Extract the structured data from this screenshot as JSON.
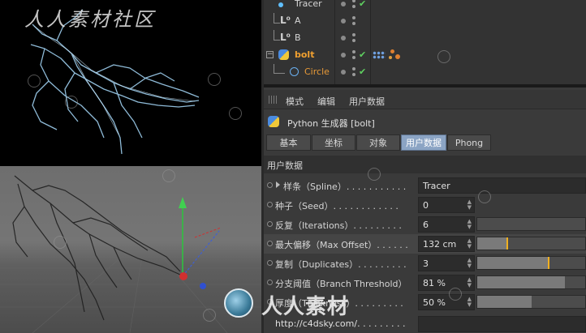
{
  "watermark": {
    "top_left": "人人素材社区",
    "center": "人人素材"
  },
  "object_manager": {
    "rows": [
      {
        "name": "Tracer"
      },
      {
        "name": "A"
      },
      {
        "name": "B"
      },
      {
        "name": "bolt"
      },
      {
        "name": "Circle"
      }
    ]
  },
  "attribute_manager": {
    "menu": [
      "模式",
      "编辑",
      "用户数据"
    ],
    "object_title": "Python 生成器 [bolt]",
    "tabs": [
      "基本",
      "坐标",
      "对象",
      "用户数据",
      "Phong"
    ],
    "active_tab": "用户数据",
    "section": "用户数据",
    "params": [
      {
        "label": "样条（Spline）. . . . . . . . . . .",
        "value": "Tracer"
      },
      {
        "label": "种子（Seed）. . . . . . . . . . . .",
        "value": "0"
      },
      {
        "label": "反复（Iterations）. . . . . . . . .",
        "value": "6",
        "fraction": 0.0
      },
      {
        "label": "最大偏移（Max Offset）. . . . . .",
        "value": "132 cm",
        "fraction": 0.28
      },
      {
        "label": "复制（Duplicates）. . . . . . . . .",
        "value": "3",
        "fraction": 0.66
      },
      {
        "label": "分支阈值（Branch Threshold）",
        "value": "81 %",
        "fraction": 0.81
      },
      {
        "label": "厚度（Thickness）. . . . . . . . .",
        "value": "50 %",
        "fraction": 0.5
      }
    ],
    "footer_url": "http://c4dsky.com/. . . . . . . . ."
  },
  "colors": {
    "accent_tab": "#8ba4c4",
    "check_green": "#5fd060",
    "object_orange": "#f0a030",
    "lightning_blue": "#9fd0f0",
    "slider_mark": "#f0b020"
  }
}
